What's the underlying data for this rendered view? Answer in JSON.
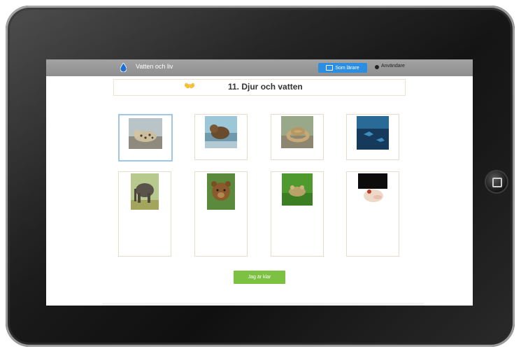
{
  "app": {
    "title": "Vatten och liv",
    "teacher_button": "Som lärare",
    "user_label": "Användare"
  },
  "lesson": {
    "title": "11. Djur och vatten",
    "continue_button": "Jag är klar"
  },
  "cards": [
    {
      "subject": "leopard"
    },
    {
      "subject": "bear-in-water"
    },
    {
      "subject": "snake"
    },
    {
      "subject": "underwater"
    },
    {
      "subject": "elephant"
    },
    {
      "subject": "brown-bear"
    },
    {
      "subject": "frog"
    },
    {
      "subject": "animal-closeup"
    }
  ],
  "colors": {
    "app_bar": "#999999",
    "teacher_button": "#2b8ee0",
    "continue_button": "#7cc142",
    "card_border": "#e6dccb",
    "selected_border": "#9fc6e6"
  }
}
